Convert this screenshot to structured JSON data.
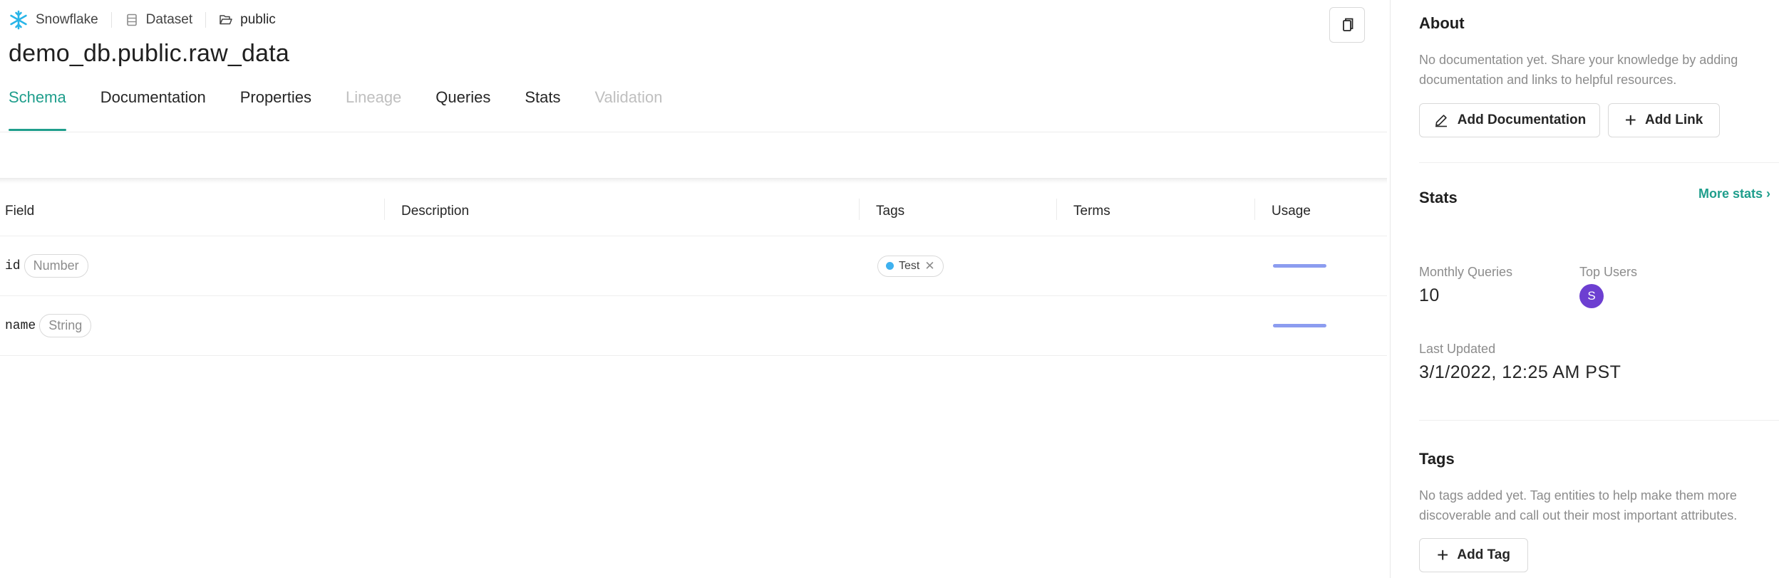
{
  "breadcrumb": {
    "platform": "Snowflake",
    "entity_type": "Dataset",
    "container": "public"
  },
  "title": "demo_db.public.raw_data",
  "tabs": [
    {
      "label": "Schema",
      "state": "active"
    },
    {
      "label": "Documentation",
      "state": "normal"
    },
    {
      "label": "Properties",
      "state": "normal"
    },
    {
      "label": "Lineage",
      "state": "disabled"
    },
    {
      "label": "Queries",
      "state": "normal"
    },
    {
      "label": "Stats",
      "state": "normal"
    },
    {
      "label": "Validation",
      "state": "disabled"
    }
  ],
  "table": {
    "columns": [
      "Field",
      "Description",
      "Tags",
      "Terms",
      "Usage"
    ],
    "rows": [
      {
        "field": "id",
        "type": "Number",
        "tag": "Test",
        "usage_fraction": 1.0
      },
      {
        "field": "name",
        "type": "String",
        "tag": "",
        "usage_fraction": 1.0
      }
    ]
  },
  "sidebar": {
    "about": {
      "heading": "About",
      "text": "No documentation yet. Share your knowledge by adding documentation and links to helpful resources.",
      "add_doc_label": "Add Documentation",
      "add_link_label": "Add Link"
    },
    "stats": {
      "heading": "Stats",
      "more_label": "More stats",
      "monthly_queries_label": "Monthly Queries",
      "monthly_queries_value": "10",
      "top_users_label": "Top Users",
      "top_user_initial": "S",
      "last_updated_label": "Last Updated",
      "last_updated_value": "3/1/2022, 12:25 AM PST"
    },
    "tags": {
      "heading": "Tags",
      "text": "No tags added yet. Tag entities to help make them more discoverable and call out their most important attributes.",
      "add_tag_label": "Add Tag"
    }
  },
  "colors": {
    "accent": "#1f9e8c",
    "tag_dot": "#3eb1ef",
    "usage_bar": "#8c9cf0",
    "avatar": "#6d3fd1"
  }
}
